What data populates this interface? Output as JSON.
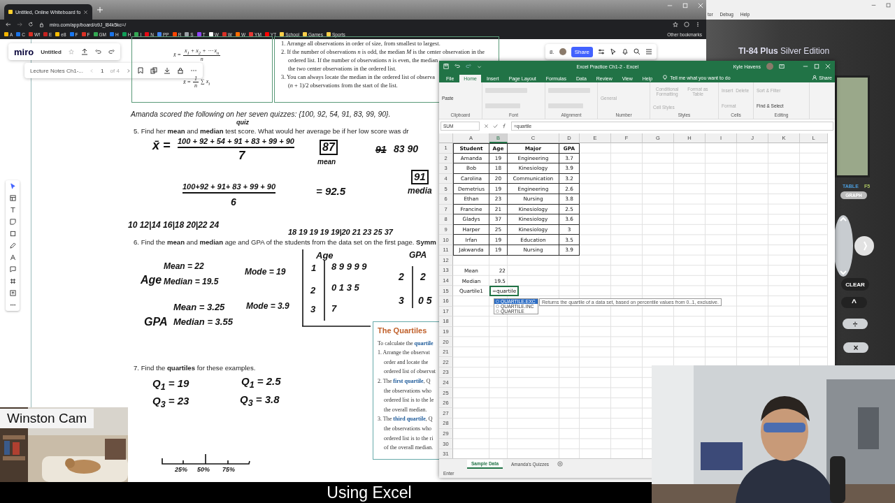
{
  "browser": {
    "tab_title": "Untitled, Online Whiteboard fo",
    "url": "miro.com/app/board/o9J_l84k5kc=/",
    "other_bookmarks": "Other bookmarks",
    "bookmarks": [
      {
        "label": "A",
        "color": "#f4b400"
      },
      {
        "label": "C",
        "color": "#1a73e8"
      },
      {
        "label": "Wf",
        "color": "#d93025"
      },
      {
        "label": "E",
        "color": "#c5221f"
      },
      {
        "label": "e8",
        "color": "#fbbc04"
      },
      {
        "label": "F",
        "color": "#1877f2"
      },
      {
        "label": "F",
        "color": "#d93025"
      },
      {
        "label": "GM",
        "color": "#34a853"
      },
      {
        "label": "H",
        "color": "#1a73e8"
      },
      {
        "label": "H",
        "color": "#0f9d58"
      },
      {
        "label": "I",
        "color": "#34a853"
      },
      {
        "label": "N",
        "color": "#e50914"
      },
      {
        "label": "PP",
        "color": "#4285f4"
      },
      {
        "label": "R",
        "color": "#ff4500"
      },
      {
        "label": "S",
        "color": "#9aa0a6"
      },
      {
        "label": "T",
        "color": "#9146ff"
      },
      {
        "label": "W",
        "color": "#ffffff"
      },
      {
        "label": "W",
        "color": "#d93025"
      },
      {
        "label": "W",
        "color": "#ff6d00"
      },
      {
        "label": "YM",
        "color": "#e53935"
      },
      {
        "label": "YT",
        "color": "#ff0000"
      },
      {
        "label": "School",
        "color": "#f9ce4a"
      },
      {
        "label": "Games",
        "color": "#f9ce4a"
      },
      {
        "label": "Sports",
        "color": "#f9ce4a"
      }
    ]
  },
  "miro": {
    "logo": "miro",
    "board_name": "Untitled",
    "doc_name": "Lecture Notes Ch1-...",
    "page": "1",
    "page_count": "of 4",
    "counter": "8.",
    "share": "Share"
  },
  "document": {
    "formulas": [
      {
        "lhs": "x̄ =",
        "numerator": "x$_{1}$ + x$_{2}$ + ⋯ x$_{n}$",
        "denominator": "n"
      },
      {
        "lhs": "x̄ =",
        "numerator": "1",
        "denominator": "n",
        "tail": "∑ x$_{i}$"
      }
    ],
    "steps": [
      {
        "text": "1.  Arrange all observations in order of size, from smallest to largest.",
        "kind": "item"
      },
      {
        "text": "2.  If the number of observations *n* is odd, the median *M* is the center observation in the",
        "kind": "item"
      },
      {
        "text": "ordered list. If the number of observations *n* is even, the median",
        "kind": "continuation"
      },
      {
        "text": "the two center observations in the ordered list.",
        "kind": "continuation"
      },
      {
        "text": "3.  You can always locate the median in the ordered list of observa",
        "kind": "item"
      },
      {
        "text": "(*n* + 1)/2 observations from the start of the list.",
        "kind": "continuation"
      }
    ],
    "intro": "Amanda scored the following on her seven quizzes: {100, 92, 54, 91, 83, 99, 90}.",
    "questions": [
      "5.   Find her **mean** and **median** test score. What would her average be if her low score was dr",
      "6.   Find the **mean** and **median** age and GPA of the students from the data set on the first page. **Symm**",
      "7.   Find the **quartiles** for these examples."
    ],
    "quartiles_box": {
      "title": "The Quartiles",
      "lines": [
        {
          "text": "To calculate the **quartile**",
          "kind": "lead"
        },
        {
          "text": "1.  Arrange the observat",
          "kind": "item"
        },
        {
          "text": "order and locate the",
          "kind": "continuation"
        },
        {
          "text": "ordered list of observat",
          "kind": "continuation"
        },
        {
          "text": "2.  The **first quartile**, Q",
          "kind": "item"
        },
        {
          "text": "the observations who",
          "kind": "continuation"
        },
        {
          "text": "ordered list is to the le",
          "kind": "continuation"
        },
        {
          "text": "the overall median.",
          "kind": "continuation"
        },
        {
          "text": "3.  The **third quartile**, Q",
          "kind": "item"
        },
        {
          "text": "the observations who",
          "kind": "continuation"
        },
        {
          "text": "ordered list is to the ri",
          "kind": "continuation"
        },
        {
          "text": "of the overall median.",
          "kind": "continuation"
        }
      ]
    }
  },
  "notes": [
    {
      "text": "quiz",
      "kind": "plain"
    },
    {
      "text": "x̄ =",
      "kind": "plain"
    },
    {
      "text": "100 + 92 + 54 + 91 + 83 + 99 + 90",
      "kind": "numerator"
    },
    {
      "text": "7",
      "kind": "plain"
    },
    {
      "text": "87",
      "kind": "boxed"
    },
    {
      "text": "mean",
      "kind": "plain"
    },
    {
      "text": "91",
      "kind": "struck"
    },
    {
      "text": "83   90",
      "kind": "plain"
    },
    {
      "text": "91",
      "kind": "boxed"
    },
    {
      "text": "media",
      "kind": "plain"
    },
    {
      "text": "100+92 + 91+ 83 + 99 + 90",
      "kind": "numerator"
    },
    {
      "text": "= 92.5",
      "kind": "plain"
    },
    {
      "text": "6",
      "kind": "plain"
    },
    {
      "text": "10  12|14  16|18  20|22  24",
      "kind": "plain"
    },
    {
      "text": "18 19 19 19 19|20 21 23 25 37",
      "kind": "plain"
    },
    {
      "text": "Age",
      "kind": "plain"
    },
    {
      "text": "Mean = 22",
      "kind": "plain"
    },
    {
      "text": "Median = 19.5",
      "kind": "plain"
    },
    {
      "text": "Mode = 19",
      "kind": "plain"
    },
    {
      "text": "GPA",
      "kind": "plain"
    },
    {
      "text": "Mean = 3.25",
      "kind": "plain"
    },
    {
      "text": "Median = 3.55",
      "kind": "plain"
    },
    {
      "text": "Mode = 3.9",
      "kind": "plain"
    },
    {
      "text": "Age",
      "kind": "plain"
    },
    {
      "text": "1",
      "kind": "plain"
    },
    {
      "text": "8  9  9  9  9",
      "kind": "plain"
    },
    {
      "text": "2",
      "kind": "plain"
    },
    {
      "text": "0  1  3  5",
      "kind": "plain"
    },
    {
      "text": "3",
      "kind": "plain"
    },
    {
      "text": "7",
      "kind": "plain"
    },
    {
      "text": "GPA",
      "kind": "plain"
    },
    {
      "text": "2",
      "kind": "plain"
    },
    {
      "text": "2",
      "kind": "plain"
    },
    {
      "text": "3",
      "kind": "plain"
    },
    {
      "text": "0  5",
      "kind": "plain"
    },
    {
      "text": "Q$_{1}$ = 19",
      "kind": "plain"
    },
    {
      "text": "Q$_{3}$ = 23",
      "kind": "plain"
    },
    {
      "text": "Q$_{1}$ = 2.5",
      "kind": "plain"
    },
    {
      "text": "Q$_{3}$ = 3.8",
      "kind": "plain"
    },
    {
      "text": "25%",
      "kind": "plain"
    },
    {
      "text": "50%",
      "kind": "plain"
    },
    {
      "text": "75%",
      "kind": "plain"
    }
  ],
  "excel": {
    "title": "Excel Practice Ch1-2  -  Excel",
    "user": "Kyle Havens",
    "tabs": [
      {
        "label": "File",
        "selected": false
      },
      {
        "label": "Home",
        "selected": true
      },
      {
        "label": "Insert",
        "selected": false
      },
      {
        "label": "Page Layout",
        "selected": false
      },
      {
        "label": "Formulas",
        "selected": false
      },
      {
        "label": "Data",
        "selected": false
      },
      {
        "label": "Review",
        "selected": false
      },
      {
        "label": "View",
        "selected": false
      },
      {
        "label": "Help",
        "selected": false
      }
    ],
    "tell_me": "Tell me what you want to do",
    "share": "Share",
    "groups": [
      {
        "name": "Clipboard",
        "buttons": [
          {
            "label": "Paste",
            "disabled": false
          }
        ]
      },
      {
        "name": "Font"
      },
      {
        "name": "Alignment"
      },
      {
        "name": "Number",
        "buttons": [
          {
            "label": "General",
            "disabled": true
          }
        ]
      },
      {
        "name": "Styles",
        "buttons": [
          {
            "label": "Conditional Formatting",
            "disabled": true
          },
          {
            "label": "Format as Table",
            "disabled": true
          },
          {
            "label": "Cell Styles",
            "disabled": true
          }
        ]
      },
      {
        "name": "Cells",
        "buttons": [
          {
            "label": "Insert",
            "disabled": true
          },
          {
            "label": "Delete",
            "disabled": true
          },
          {
            "label": "Format",
            "disabled": true
          }
        ]
      },
      {
        "name": "Editing",
        "buttons": [
          {
            "label": "Sort & Filter",
            "disabled": true
          },
          {
            "label": "Find & Select",
            "disabled": false
          }
        ]
      }
    ],
    "name_box": "SUM",
    "formula": "=quartile",
    "columns": [
      {
        "label": "A",
        "selected": false
      },
      {
        "label": "B",
        "selected": true
      },
      {
        "label": "C",
        "selected": false
      },
      {
        "label": "D",
        "selected": false
      },
      {
        "label": "E",
        "selected": false
      },
      {
        "label": "F",
        "selected": false
      },
      {
        "label": "G",
        "selected": false
      },
      {
        "label": "H",
        "selected": false
      },
      {
        "label": "I",
        "selected": false
      },
      {
        "label": "J",
        "selected": false
      },
      {
        "label": "K",
        "selected": false
      },
      {
        "label": "L",
        "selected": false
      }
    ],
    "row_numbers": [
      "1",
      "2",
      "3",
      "4",
      "5",
      "6",
      "7",
      "8",
      "9",
      "10",
      "11",
      "12",
      "13",
      "14",
      "15",
      "16",
      "17",
      "18",
      "19",
      "20",
      "21",
      "22",
      "23",
      "24",
      "25",
      "26",
      "27",
      "28",
      "29",
      "30",
      "31"
    ],
    "table": [
      [
        "Student",
        "Age",
        "Major",
        "GPA"
      ],
      [
        "Amanda",
        "19",
        "Engineering",
        "3.7"
      ],
      [
        "Bob",
        "18",
        "Kinesiology",
        "3.9"
      ],
      [
        "Carolina",
        "20",
        "Communication",
        "3.2"
      ],
      [
        "Demetrius",
        "19",
        "Engineering",
        "2.6"
      ],
      [
        "Ethan",
        "23",
        "Nursing",
        "3.8"
      ],
      [
        "Francine",
        "21",
        "Kinesiology",
        "2.5"
      ],
      [
        "Gladys",
        "37",
        "Kinesiology",
        "3.6"
      ],
      [
        "Harper",
        "25",
        "Kinesiology",
        "3"
      ],
      [
        "Irfan",
        "19",
        "Education",
        "3.5"
      ],
      [
        "Jakwanda",
        "19",
        "Nursing",
        "3.9"
      ]
    ],
    "summary": [
      {
        "label": "Mean",
        "value": "22",
        "active": false
      },
      {
        "label": "Median",
        "value": "19.5",
        "active": false
      },
      {
        "label": "Quartile1",
        "value": "=quartile",
        "active": true
      }
    ],
    "autocomplete": [
      {
        "label": "QUARTILE.EXC",
        "selected": true
      },
      {
        "label": "QUARTILE.INC",
        "selected": false
      },
      {
        "label": "QUARTILE",
        "selected": false
      }
    ],
    "tooltip": "Returns the quartile of a data set, based on percentile values from 0..1, exclusive.",
    "sheets": [
      {
        "label": "Sample Data",
        "selected": true
      },
      {
        "label": "Amanda's Quizzes",
        "selected": false
      }
    ],
    "status": "Enter"
  },
  "calculator": {
    "menu": [
      "tor",
      "Debug",
      "Help"
    ],
    "title": "TI-84 Plus",
    "edition": "Silver Edition",
    "table_label": "TABLE",
    "f5_label": "F5",
    "graph_key": "GRAPH",
    "clear_key": "CLEAR",
    "keys": [
      "^",
      "÷",
      "×"
    ]
  },
  "webcam": {
    "label": "Winston Cam"
  },
  "caption": "Using Excel"
}
